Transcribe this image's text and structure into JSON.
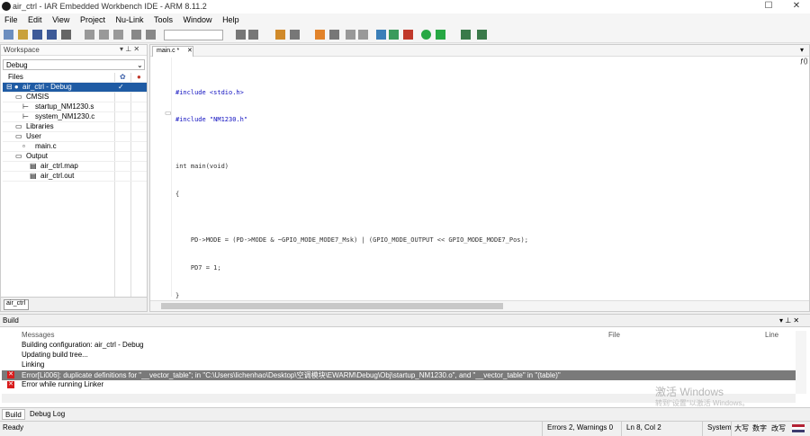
{
  "window": {
    "title": "air_ctrl - IAR Embedded Workbench IDE - ARM 8.11.2"
  },
  "menu": [
    "File",
    "Edit",
    "View",
    "Project",
    "Nu-Link",
    "Tools",
    "Window",
    "Help"
  ],
  "workspace": {
    "title": "Workspace",
    "config": "Debug",
    "files_header": "Files",
    "tree": [
      {
        "label": "air_ctrl - Debug",
        "indent": 0,
        "selected": true
      },
      {
        "label": "CMSIS",
        "indent": 1
      },
      {
        "label": "startup_NM1230.s",
        "indent": 2
      },
      {
        "label": "system_NM1230.c",
        "indent": 2
      },
      {
        "label": "Libraries",
        "indent": 1
      },
      {
        "label": "User",
        "indent": 1
      },
      {
        "label": "main.c",
        "indent": 2
      },
      {
        "label": "Output",
        "indent": 1
      },
      {
        "label": "air_ctrl.map",
        "indent": 2
      },
      {
        "label": "air_ctrl.out",
        "indent": 2
      }
    ],
    "tab": "air_ctrl"
  },
  "editor": {
    "tab": "main.c *",
    "code": [
      "#include <stdio.h>",
      "#include \"NM1230.h\"",
      "",
      "int main(void)",
      "{",
      "",
      "    PD->MODE = (PD->MODE & ~GPIO_MODE_MODE7_Msk) | (GPIO_MODE_OUTPUT << GPIO_MODE_MODE7_Pos);",
      "    PD7 = 1;",
      "}"
    ]
  },
  "build": {
    "title": "Build",
    "columns": [
      "Messages",
      "File",
      "Line"
    ],
    "rows": [
      {
        "text": "Building configuration: air_ctrl - Debug",
        "error": false
      },
      {
        "text": "Updating build tree...",
        "error": false
      },
      {
        "text": "Linking",
        "error": false
      },
      {
        "text": "Error[Li006]: duplicate definitions for \"__vector_table\"; in \"C:\\Users\\lichenhao\\Desktop\\空调模块\\EWARM\\Debug\\Obj\\startup_NM1230.o\", and \"__vector_table\" in \"(table)\"",
        "error": true
      },
      {
        "text": "Error while running Linker",
        "error": true
      }
    ],
    "tabs": [
      "Build",
      "Debug Log"
    ]
  },
  "status": {
    "ready": "Ready",
    "errors": "Errors 2, Warnings 0",
    "position": "Ln 8, Col 2",
    "encoding": "System",
    "ime": [
      "大写",
      "数字",
      "改写"
    ]
  },
  "watermark": {
    "line1": "激活 Windows",
    "line2": "转到\"设置\"以激活 Windows。"
  }
}
